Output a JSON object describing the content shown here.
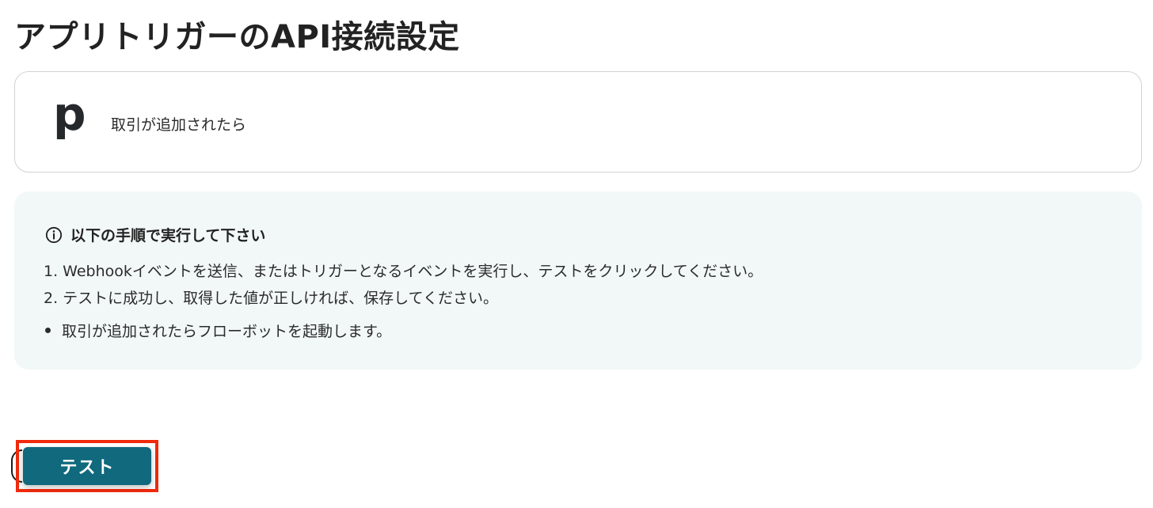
{
  "page": {
    "title": "アプリトリガーのAPI接続設定"
  },
  "trigger": {
    "app_logo": "p",
    "label": "取引が追加されたら"
  },
  "instructions": {
    "heading": "以下の手順で実行して下さい",
    "icon": "info-circle-icon",
    "steps": [
      "1. Webhookイベントを送信、またはトリガーとなるイベントを実行し、テストをクリックしてください。",
      "2. テストに成功し、取得した値が正しければ、保存してください。"
    ],
    "bullets": [
      "取引が追加されたらフローボットを起動します。"
    ]
  },
  "actions": {
    "test_label": "テスト"
  },
  "colors": {
    "button_bg": "#10697c",
    "info_bg": "#f2f8f8",
    "highlight_border": "#f02a0c"
  }
}
